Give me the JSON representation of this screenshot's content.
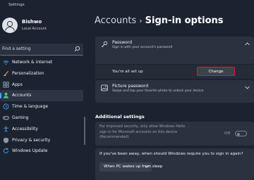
{
  "window": {
    "title": "Settings"
  },
  "profile": {
    "name": "Bishwo",
    "account_type": "Local Account"
  },
  "search": {
    "placeholder": "Find a setting"
  },
  "nav": [
    {
      "label": "Network & internet",
      "icon": "wifi-icon",
      "color": "#4ba6ff"
    },
    {
      "label": "Personalization",
      "icon": "brush-icon",
      "color": "#e9a05b"
    },
    {
      "label": "Apps",
      "icon": "apps-icon",
      "color": "#9bb0c8"
    },
    {
      "label": "Accounts",
      "icon": "person-icon",
      "color": "#4ec48c",
      "active": true
    },
    {
      "label": "Time & language",
      "icon": "globe-clock-icon",
      "color": "#4ba6ff"
    },
    {
      "label": "Gaming",
      "icon": "gamepad-icon",
      "color": "#c6cbd3"
    },
    {
      "label": "Accessibility",
      "icon": "accessibility-icon",
      "color": "#4ba6ff"
    },
    {
      "label": "Privacy & security",
      "icon": "shield-icon",
      "color": "#8d99ab"
    },
    {
      "label": "Windows Update",
      "icon": "update-icon",
      "color": "#4ba6ff"
    }
  ],
  "breadcrumb": {
    "parent": "Accounts",
    "separator": "›",
    "current": "Sign-in options"
  },
  "password_card": {
    "title": "Password",
    "subtitle": "Sign in with your account's password",
    "status": "You're all set up",
    "change_label": "Change"
  },
  "picture_card": {
    "title": "Picture password",
    "subtitle": "Swipe and tap your favorite photo to unlock your device"
  },
  "additional": {
    "heading": "Additional settings",
    "hello_text": "For improved security, only allow Windows Hello sign-in for Microsoft accounts on this device (Recommended)",
    "toggle_state": "Off"
  },
  "away": {
    "question": "If you've been away, when should Windows require you to sign in again?",
    "selected": "When PC wakes up from sleep"
  },
  "colors": {
    "accent": "#4ba6ff",
    "highlight_border": "#d81f26",
    "background": "#1c2330"
  }
}
